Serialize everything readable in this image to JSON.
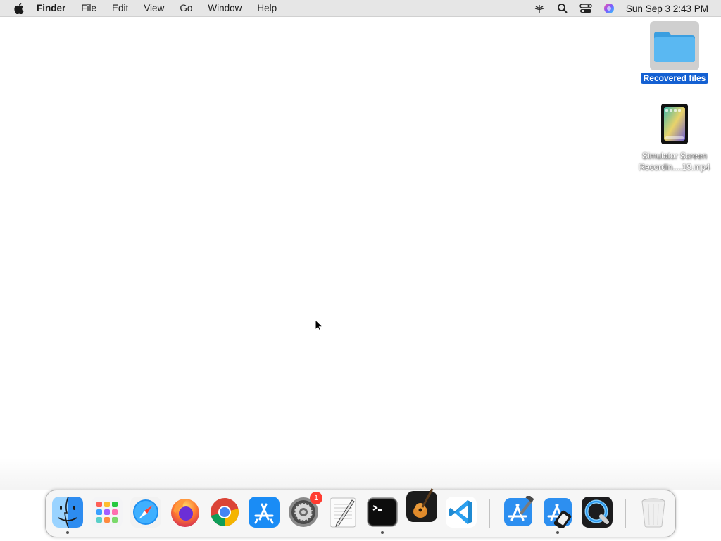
{
  "menubar": {
    "apple_icon": "apple-logo-icon",
    "app_name": "Finder",
    "items": [
      "File",
      "Edit",
      "View",
      "Go",
      "Window",
      "Help"
    ],
    "status_icons": [
      "network-icon",
      "search-icon",
      "control-center-icon",
      "siri-icon"
    ],
    "clock": "Sun Sep 3  2:43 PM"
  },
  "desktop": {
    "icons": [
      {
        "label": "Recovered files",
        "icon": "folder-icon",
        "selected": true
      },
      {
        "label_line1": "Simulator Screen",
        "label_line2": "Recordin....19.mp4",
        "icon": "video-file-icon"
      }
    ]
  },
  "dock": {
    "apps": [
      {
        "name": "Finder",
        "icon": "finder-icon",
        "running": true
      },
      {
        "name": "Launchpad",
        "icon": "launchpad-icon",
        "running": false
      },
      {
        "name": "Safari",
        "icon": "safari-icon",
        "running": false
      },
      {
        "name": "Firefox",
        "icon": "firefox-icon",
        "running": false
      },
      {
        "name": "Chrome",
        "icon": "chrome-icon",
        "running": false
      },
      {
        "name": "App Store",
        "icon": "app-store-icon",
        "running": false
      },
      {
        "name": "System Settings",
        "icon": "settings-icon",
        "running": false,
        "badge": "1"
      },
      {
        "name": "TextEdit",
        "icon": "textedit-icon",
        "running": false
      },
      {
        "name": "Terminal",
        "icon": "terminal-icon",
        "running": true
      },
      {
        "name": "GarageBand",
        "icon": "garageband-icon",
        "running": false
      },
      {
        "name": "Visual Studio Code",
        "icon": "vscode-icon",
        "running": false
      },
      {
        "name": "Xcode",
        "icon": "xcode-icon",
        "running": false
      },
      {
        "name": "Simulator",
        "icon": "simulator-icon",
        "running": true
      },
      {
        "name": "QuickTime Player",
        "icon": "quicktime-icon",
        "running": false
      },
      {
        "name": "Trash",
        "icon": "trash-icon",
        "running": false
      }
    ]
  },
  "colors": {
    "menubar_bg": "#e6e6e6",
    "selection_blue": "#1460d2",
    "folder_blue": "#5ab4f0",
    "badge_red": "#ff3b30"
  }
}
